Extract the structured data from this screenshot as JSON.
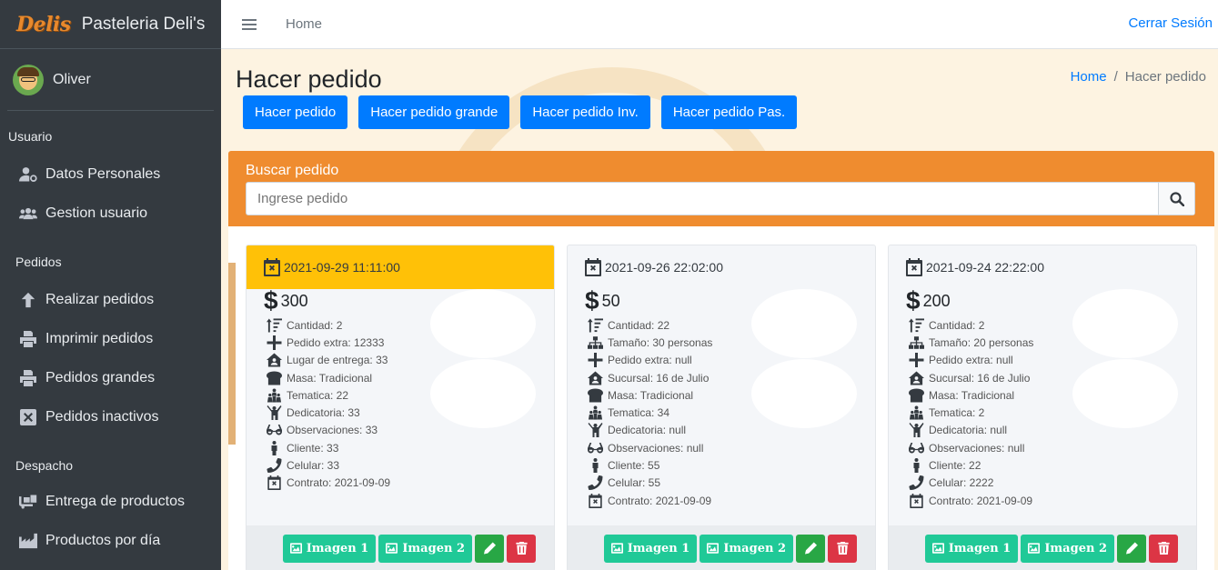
{
  "brand": {
    "logo": "Delis",
    "name": "Pasteleria Deli's"
  },
  "user": {
    "name": "Oliver"
  },
  "sidebar": {
    "sections": [
      {
        "header": "Usuario",
        "items": [
          {
            "label": "Datos Personales",
            "icon": "user-cog-icon"
          },
          {
            "label": "Gestion usuario",
            "icon": "users-icon"
          }
        ]
      },
      {
        "header": "Pedidos",
        "items": [
          {
            "label": "Realizar pedidos",
            "icon": "arrow-up-icon"
          },
          {
            "label": "Imprimir pedidos",
            "icon": "printer-icon"
          },
          {
            "label": "Pedidos grandes",
            "icon": "printer-icon"
          },
          {
            "label": "Pedidos inactivos",
            "icon": "x-square-icon"
          }
        ]
      },
      {
        "header": "Despacho",
        "items": [
          {
            "label": "Entrega de productos",
            "icon": "truck-loading-icon"
          },
          {
            "label": "Productos por día",
            "icon": "industry-icon"
          }
        ]
      }
    ]
  },
  "topbar": {
    "home": "Home",
    "logout": "Cerrar Sesión"
  },
  "page": {
    "title": "Hacer pedido",
    "breadcrumb": {
      "home": "Home",
      "separator": "/",
      "current": "Hacer pedido"
    },
    "buttons": [
      "Hacer pedido",
      "Hacer pedido grande",
      "Hacer pedido Inv.",
      "Hacer pedido Pas."
    ]
  },
  "search": {
    "title": "Buscar pedido",
    "placeholder": "Ingrese pedido"
  },
  "orders": [
    {
      "date": "2021-09-29 11:11:00",
      "highlighted": true,
      "price": "300",
      "fields": [
        {
          "icon": "sort-amount-icon",
          "text": "Cantidad: 2"
        },
        {
          "icon": "plus-icon",
          "text": "Pedido extra: 12333"
        },
        {
          "icon": "house-user-icon",
          "text": "Lugar de entrega: 33"
        },
        {
          "icon": "bread-icon",
          "text": "Masa: Tradicional"
        },
        {
          "icon": "child-group-icon",
          "text": "Tematica: 22"
        },
        {
          "icon": "person-raise-icon",
          "text": "Dedicatoria: 33"
        },
        {
          "icon": "glasses-icon",
          "text": "Observaciones: 33"
        },
        {
          "icon": "person-icon",
          "text": "Cliente: 33"
        },
        {
          "icon": "phone-icon",
          "text": "Celular: 33"
        },
        {
          "icon": "calendar-x-icon",
          "text": "Contrato: 2021-09-09"
        }
      ]
    },
    {
      "date": "2021-09-26 22:02:00",
      "highlighted": false,
      "price": "50",
      "fields": [
        {
          "icon": "sort-amount-icon",
          "text": "Cantidad: 22"
        },
        {
          "icon": "sitemap-icon",
          "text": "Tamaño: 30 personas"
        },
        {
          "icon": "plus-icon",
          "text": "Pedido extra: null"
        },
        {
          "icon": "house-user-icon",
          "text": "Sucursal: 16 de Julio"
        },
        {
          "icon": "bread-icon",
          "text": "Masa: Tradicional"
        },
        {
          "icon": "child-group-icon",
          "text": "Tematica: 34"
        },
        {
          "icon": "person-raise-icon",
          "text": "Dedicatoria: null"
        },
        {
          "icon": "glasses-icon",
          "text": "Observaciones: null"
        },
        {
          "icon": "person-icon",
          "text": "Cliente: 55"
        },
        {
          "icon": "phone-icon",
          "text": "Celular: 55"
        },
        {
          "icon": "calendar-x-icon",
          "text": "Contrato: 2021-09-09"
        }
      ]
    },
    {
      "date": "2021-09-24 22:22:00",
      "highlighted": false,
      "price": "200",
      "fields": [
        {
          "icon": "sort-amount-icon",
          "text": "Cantidad: 2"
        },
        {
          "icon": "sitemap-icon",
          "text": "Tamaño: 20 personas"
        },
        {
          "icon": "plus-icon",
          "text": "Pedido extra: null"
        },
        {
          "icon": "house-user-icon",
          "text": "Sucursal: 16 de Julio"
        },
        {
          "icon": "bread-icon",
          "text": "Masa: Tradicional"
        },
        {
          "icon": "child-group-icon",
          "text": "Tematica: 2"
        },
        {
          "icon": "person-raise-icon",
          "text": "Dedicatoria: null"
        },
        {
          "icon": "glasses-icon",
          "text": "Observaciones: null"
        },
        {
          "icon": "person-icon",
          "text": "Cliente: 22"
        },
        {
          "icon": "phone-icon",
          "text": "Celular: 2222"
        },
        {
          "icon": "calendar-x-icon",
          "text": "Contrato: 2021-09-09"
        }
      ]
    }
  ],
  "card_actions": {
    "image1": "Imagen 1",
    "image2": "Imagen 2"
  },
  "colors": {
    "sidebar": "#343a40",
    "primary": "#007bff",
    "orange": "#ef8c2f",
    "highlight": "#ffc107",
    "teal": "#20c997",
    "success": "#28a745",
    "danger": "#dc3545"
  }
}
